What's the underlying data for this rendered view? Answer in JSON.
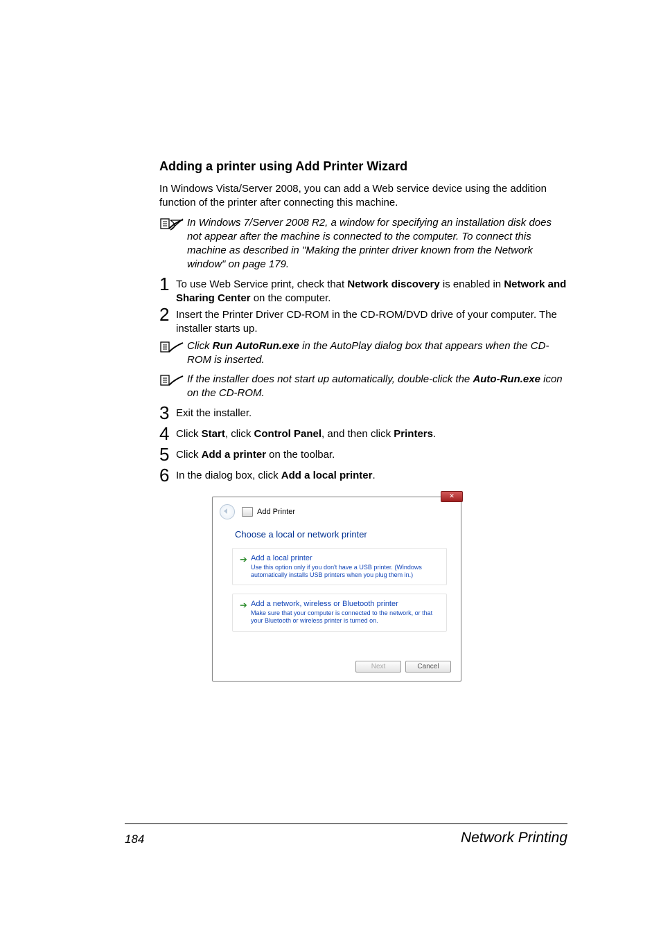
{
  "heading": "Adding a printer using Add Printer Wizard",
  "intro": "In Windows Vista/Server 2008, you can add a Web service device using the addition function of the printer after connecting this machine.",
  "note1_pre": "In Windows 7/Server 2008 R2, a window for specifying an installation disk does not appear after the machine is connected to the computer. To connect this machine as described in \"Making the printer driver known from the Network window\" on page 179.",
  "step1_a": "To use Web Service print, check that ",
  "step1_b": "Network discovery",
  "step1_c": " is enabled in ",
  "step1_d": "Network and Sharing Center",
  "step1_e": " on the computer.",
  "step2": "Insert the Printer Driver CD-ROM in the CD-ROM/DVD drive of your computer. The installer starts up.",
  "note2_a": "Click ",
  "note2_b": "Run AutoRun.exe",
  "note2_c": " in the AutoPlay dialog box that appears when the CD-ROM is inserted.",
  "note3_a": "If the installer does not start up automatically, double-click the ",
  "note3_b": "Auto-Run.exe",
  "note3_c": " icon on the CD-ROM.",
  "step3": "Exit the installer.",
  "step4_a": "Click ",
  "step4_b": "Start",
  "step4_c": ", click ",
  "step4_d": "Control Panel",
  "step4_e": ", and then click ",
  "step4_f": "Printers",
  "step4_g": ".",
  "step5_a": "Click ",
  "step5_b": "Add a printer",
  "step5_c": " on the toolbar.",
  "step6_a": "In the dialog box, click ",
  "step6_b": "Add a local printer",
  "step6_c": ".",
  "dialog": {
    "header_label": "Add Printer",
    "main_title": "Choose a local or network printer",
    "opt1_title": "Add a local printer",
    "opt1_desc": "Use this option only if you don't have a USB printer. (Windows automatically installs USB printers when you plug them in.)",
    "opt2_title": "Add a network, wireless or Bluetooth printer",
    "opt2_desc": "Make sure that your computer is connected to the network, or that your Bluetooth or wireless printer is turned on.",
    "btn_next": "Next",
    "btn_cancel": "Cancel"
  },
  "footer_page": "184",
  "footer_title": "Network Printing"
}
